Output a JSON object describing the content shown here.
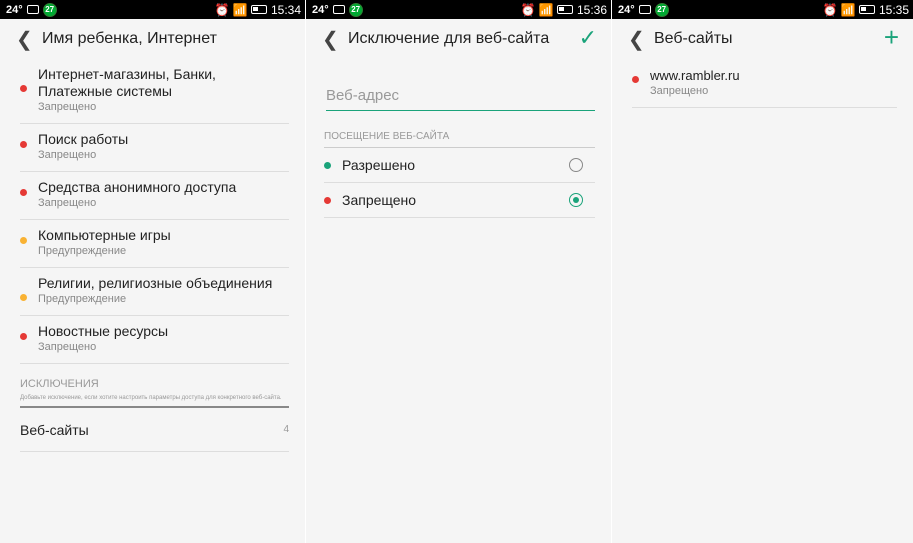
{
  "status_bars": [
    {
      "temp": "24°",
      "badge": "27",
      "time": "15:34"
    },
    {
      "temp": "24°",
      "badge": "27",
      "time": "15:36"
    },
    {
      "temp": "24°",
      "badge": "27",
      "time": "15:35"
    }
  ],
  "colors": {
    "red": "#e53935",
    "orange": "#f9b233",
    "green": "#1aa37a"
  },
  "panel1": {
    "title": "Имя ребенка, Интернет",
    "items": [
      {
        "title": "Интернет-магазины, Банки, Платежные системы",
        "status": "Запрещено",
        "color": "red"
      },
      {
        "title": "Поиск работы",
        "status": "Запрещено",
        "color": "red"
      },
      {
        "title": "Средства анонимного доступа",
        "status": "Запрещено",
        "color": "red"
      },
      {
        "title": "Компьютерные игры",
        "status": "Предупреждение",
        "color": "orange"
      },
      {
        "title": "Религии, религиозные объединения",
        "status": "Предупреждение",
        "color": "orange"
      },
      {
        "title": "Новостные ресурсы",
        "status": "Запрещено",
        "color": "red"
      }
    ],
    "exceptions_head": "ИСКЛЮЧЕНИЯ",
    "exceptions_note": "Добавьте исключение, если хотите настроить параметры доступа для конкретного веб-сайта.",
    "websites_label": "Веб-сайты",
    "websites_count": "4"
  },
  "panel2": {
    "title": "Исключение для веб-сайта",
    "address_placeholder": "Веб-адрес",
    "section_head": "ПОСЕЩЕНИЕ ВЕБ-САЙТА",
    "options": [
      {
        "label": "Разрешено",
        "color": "green",
        "selected": false
      },
      {
        "label": "Запрещено",
        "color": "red",
        "selected": true
      }
    ]
  },
  "panel3": {
    "title": "Веб-сайты",
    "sites": [
      {
        "url": "www.rambler.ru",
        "status": "Запрещено",
        "color": "red"
      }
    ]
  }
}
